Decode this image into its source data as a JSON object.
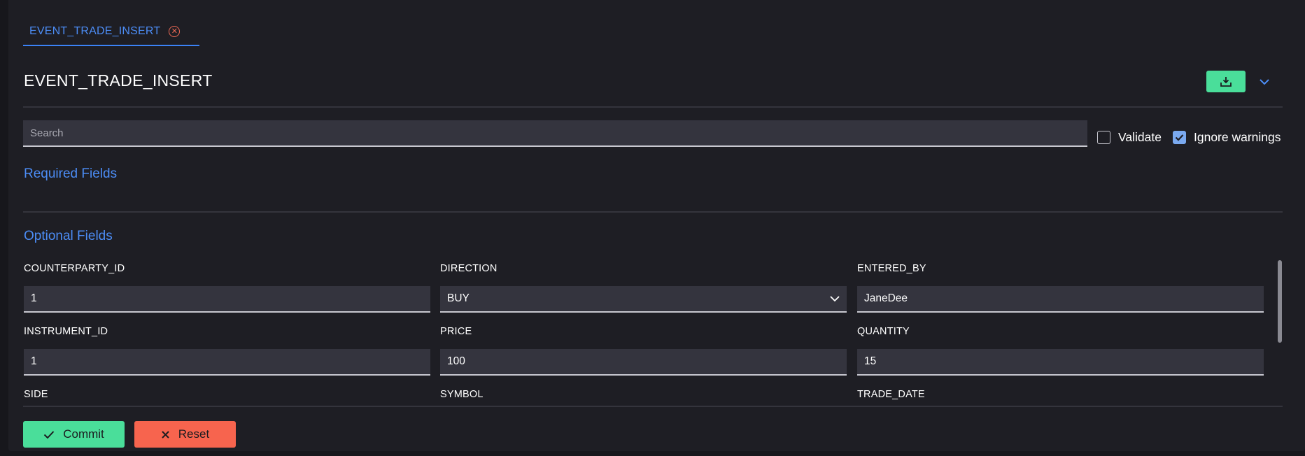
{
  "tab": {
    "label": "EVENT_TRADE_INSERT",
    "close_icon": "close-circle-icon"
  },
  "header": {
    "title": "EVENT_TRADE_INSERT",
    "export_icon": "download-icon",
    "collapse_icon": "chevron-down-icon"
  },
  "search": {
    "placeholder": "Search",
    "value": ""
  },
  "options": {
    "validate": {
      "label": "Validate",
      "checked": false
    },
    "ignore_warnings": {
      "label": "Ignore warnings",
      "checked": true
    }
  },
  "sections": {
    "required": "Required Fields",
    "optional": "Optional Fields"
  },
  "fields": [
    {
      "label": "COUNTERPARTY_ID",
      "value": "1",
      "type": "text"
    },
    {
      "label": "DIRECTION",
      "value": "BUY",
      "type": "select"
    },
    {
      "label": "ENTERED_BY",
      "value": "JaneDee",
      "type": "text"
    },
    {
      "label": "INSTRUMENT_ID",
      "value": "1",
      "type": "text"
    },
    {
      "label": "PRICE",
      "value": "100",
      "type": "text"
    },
    {
      "label": "QUANTITY",
      "value": "15",
      "type": "text"
    },
    {
      "label": "SIDE",
      "value": "",
      "type": "text"
    },
    {
      "label": "SYMBOL",
      "value": "",
      "type": "text"
    },
    {
      "label": "TRADE_DATE",
      "value": "",
      "type": "text"
    }
  ],
  "actions": {
    "commit": "Commit",
    "reset": "Reset"
  },
  "colors": {
    "accent": "#4c8df6",
    "success": "#4ade9a",
    "danger": "#f7644e",
    "background": "#1e1e24"
  }
}
